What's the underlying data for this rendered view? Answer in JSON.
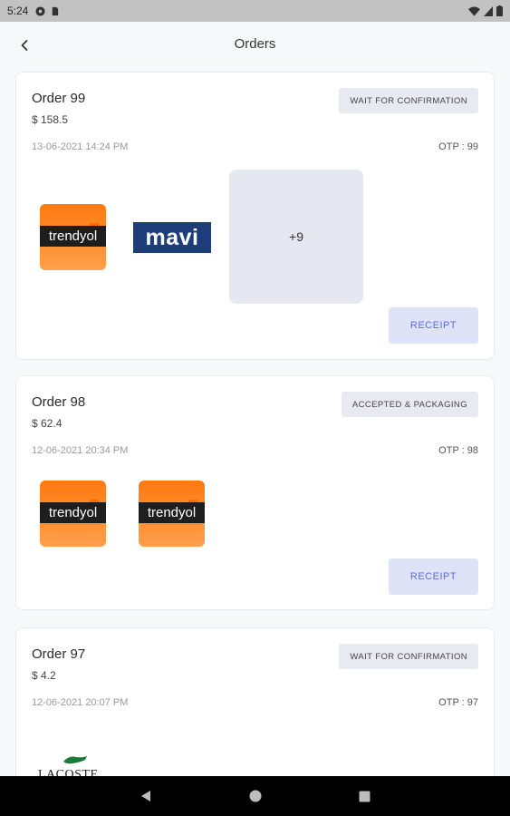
{
  "status_bar": {
    "time": "5:24"
  },
  "header": {
    "title": "Orders"
  },
  "orders": [
    {
      "title": "Order 99",
      "price": "$ 158.5",
      "status": "WAIT FOR CONFIRMATION",
      "date": "13-06-2021 14:24 PM",
      "otp": "OTP : 99",
      "brands": [
        "trendyol",
        "mavi"
      ],
      "more": "+9",
      "receipt": "RECEIPT"
    },
    {
      "title": "Order 98",
      "price": "$ 62.4",
      "status": "ACCEPTED & PACKAGING",
      "date": "12-06-2021 20:34 PM",
      "otp": "OTP : 98",
      "brands": [
        "trendyol",
        "trendyol"
      ],
      "receipt": "RECEIPT"
    },
    {
      "title": "Order 97",
      "price": "$ 4.2",
      "status": "WAIT FOR CONFIRMATION",
      "date": "12-06-2021 20:07 PM",
      "otp": "OTP : 97",
      "brands": [
        "LACOSTE"
      ]
    }
  ],
  "colors": {
    "accent": "#5b6cd4",
    "badge_bg": "#e8eaf1",
    "receipt_bg": "#dfe3f7"
  }
}
